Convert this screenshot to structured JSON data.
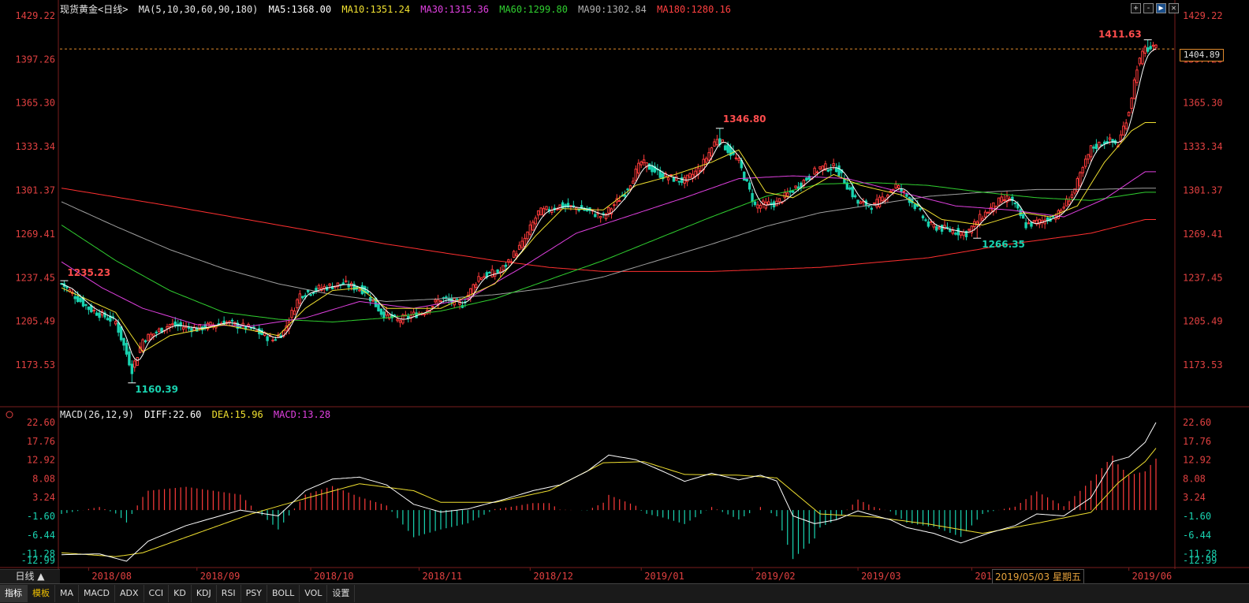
{
  "header": {
    "symbol": "现货黄金<日线>",
    "ma_params": "MA(5,10,30,60,90,180)",
    "ma5": "MA5:1368.00",
    "ma10": "MA10:1351.24",
    "ma30": "MA30:1315.36",
    "ma60": "MA60:1299.80",
    "ma90": "MA90:1302.84",
    "ma180": "MA180:1280.16"
  },
  "window_buttons": [
    "+",
    "-",
    "▶",
    "✕"
  ],
  "macd_header": {
    "params": "MACD(26,12,9)",
    "diff": "DIFF:22.60",
    "dea": "DEA:15.96",
    "macd": "MACD:13.28"
  },
  "price_axis": [
    "1429.22",
    "1397.26",
    "1365.30",
    "1333.34",
    "1301.37",
    "1269.41",
    "1237.45",
    "1205.49",
    "1173.53"
  ],
  "macd_axis": [
    "22.60",
    "17.76",
    "12.92",
    "8.08",
    "3.24",
    "-1.60",
    "-6.44",
    "-11.28",
    "-12.99"
  ],
  "x_axis": [
    "2018/08",
    "2018/09",
    "2018/10",
    "2018/11",
    "2018/12",
    "2019/01",
    "2019/02",
    "2019/03",
    "2019/04",
    "2019/06"
  ],
  "current_price": "1404.89",
  "annotations": {
    "high": "1411.63",
    "peak_feb": "1346.80",
    "start": "1235.23",
    "low_aug": "1160.39",
    "low_may": "1266.35"
  },
  "tooltip_date": "2019/05/03 星期五",
  "period_label": "日线 ▲",
  "bottom_tabs": [
    "指标",
    "模板",
    "MA",
    "MACD",
    "ADX",
    "CCI",
    "KD",
    "KDJ",
    "RSI",
    "PSY",
    "BOLL",
    "VOL",
    "设置"
  ],
  "colors": {
    "up": "#ff3b3b",
    "down": "#19d3b0",
    "ma5": "#ffffff",
    "ma10": "#f0e030",
    "ma30": "#e040e0",
    "ma60": "#30d030",
    "ma90": "#a0a0a0",
    "ma180": "#ff3030"
  },
  "chart_data": {
    "type": "candlestick",
    "title": "现货黄金<日线>",
    "ylim": [
      1160,
      1430
    ],
    "anchors": {
      "close": [
        [
          0,
          1233
        ],
        [
          10,
          1215
        ],
        [
          20,
          1205
        ],
        [
          26,
          1170
        ],
        [
          30,
          1192
        ],
        [
          40,
          1203
        ],
        [
          50,
          1200
        ],
        [
          60,
          1205
        ],
        [
          70,
          1200
        ],
        [
          78,
          1192
        ],
        [
          82,
          1198
        ],
        [
          88,
          1225
        ],
        [
          96,
          1230
        ],
        [
          104,
          1233
        ],
        [
          112,
          1228
        ],
        [
          118,
          1212
        ],
        [
          124,
          1206
        ],
        [
          134,
          1213
        ],
        [
          140,
          1222
        ],
        [
          148,
          1218
        ],
        [
          154,
          1238
        ],
        [
          162,
          1242
        ],
        [
          170,
          1262
        ],
        [
          176,
          1285
        ],
        [
          184,
          1290
        ],
        [
          192,
          1288
        ],
        [
          200,
          1282
        ],
        [
          208,
          1300
        ],
        [
          214,
          1322
        ],
        [
          222,
          1312
        ],
        [
          230,
          1308
        ],
        [
          236,
          1318
        ],
        [
          242,
          1340
        ],
        [
          250,
          1322
        ],
        [
          256,
          1290
        ],
        [
          264,
          1292
        ],
        [
          272,
          1305
        ],
        [
          280,
          1318
        ],
        [
          286,
          1318
        ],
        [
          294,
          1292
        ],
        [
          300,
          1290
        ],
        [
          308,
          1305
        ],
        [
          314,
          1293
        ],
        [
          320,
          1276
        ],
        [
          328,
          1272
        ],
        [
          334,
          1270
        ],
        [
          340,
          1283
        ],
        [
          346,
          1293
        ],
        [
          350,
          1296
        ],
        [
          356,
          1276
        ],
        [
          362,
          1279
        ],
        [
          368,
          1284
        ],
        [
          374,
          1302
        ],
        [
          380,
          1332
        ],
        [
          386,
          1338
        ],
        [
          390,
          1335
        ],
        [
          394,
          1360
        ],
        [
          397,
          1392
        ],
        [
          400,
          1405
        ]
      ],
      "ma10": [
        [
          0,
          1230
        ],
        [
          20,
          1212
        ],
        [
          30,
          1183
        ],
        [
          40,
          1195
        ],
        [
          60,
          1203
        ],
        [
          80,
          1195
        ],
        [
          90,
          1215
        ],
        [
          100,
          1228
        ],
        [
          110,
          1230
        ],
        [
          120,
          1215
        ],
        [
          140,
          1215
        ],
        [
          160,
          1233
        ],
        [
          175,
          1268
        ],
        [
          185,
          1288
        ],
        [
          200,
          1287
        ],
        [
          212,
          1305
        ],
        [
          225,
          1312
        ],
        [
          240,
          1322
        ],
        [
          250,
          1331
        ],
        [
          260,
          1300
        ],
        [
          270,
          1296
        ],
        [
          285,
          1313
        ],
        [
          295,
          1305
        ],
        [
          310,
          1298
        ],
        [
          325,
          1280
        ],
        [
          340,
          1276
        ],
        [
          355,
          1285
        ],
        [
          365,
          1282
        ],
        [
          375,
          1290
        ],
        [
          385,
          1322
        ],
        [
          395,
          1345
        ],
        [
          400,
          1351
        ]
      ],
      "ma30": [
        [
          0,
          1249
        ],
        [
          15,
          1230
        ],
        [
          30,
          1215
        ],
        [
          50,
          1203
        ],
        [
          70,
          1202
        ],
        [
          90,
          1208
        ],
        [
          110,
          1220
        ],
        [
          130,
          1215
        ],
        [
          150,
          1222
        ],
        [
          170,
          1245
        ],
        [
          190,
          1270
        ],
        [
          210,
          1283
        ],
        [
          230,
          1296
        ],
        [
          250,
          1310
        ],
        [
          270,
          1312
        ],
        [
          290,
          1310
        ],
        [
          310,
          1300
        ],
        [
          330,
          1290
        ],
        [
          350,
          1287
        ],
        [
          370,
          1282
        ],
        [
          385,
          1295
        ],
        [
          400,
          1315
        ]
      ],
      "ma60": [
        [
          0,
          1276
        ],
        [
          20,
          1250
        ],
        [
          40,
          1228
        ],
        [
          60,
          1212
        ],
        [
          80,
          1207
        ],
        [
          100,
          1205
        ],
        [
          120,
          1208
        ],
        [
          140,
          1213
        ],
        [
          160,
          1222
        ],
        [
          180,
          1236
        ],
        [
          200,
          1250
        ],
        [
          220,
          1266
        ],
        [
          240,
          1282
        ],
        [
          260,
          1297
        ],
        [
          280,
          1306
        ],
        [
          300,
          1307
        ],
        [
          320,
          1305
        ],
        [
          340,
          1300
        ],
        [
          360,
          1296
        ],
        [
          380,
          1294
        ],
        [
          400,
          1300
        ]
      ],
      "ma90": [
        [
          0,
          1293
        ],
        [
          20,
          1275
        ],
        [
          40,
          1258
        ],
        [
          60,
          1244
        ],
        [
          80,
          1233
        ],
        [
          100,
          1225
        ],
        [
          120,
          1220
        ],
        [
          140,
          1222
        ],
        [
          160,
          1225
        ],
        [
          180,
          1230
        ],
        [
          200,
          1238
        ],
        [
          220,
          1250
        ],
        [
          240,
          1262
        ],
        [
          260,
          1275
        ],
        [
          280,
          1285
        ],
        [
          300,
          1291
        ],
        [
          320,
          1297
        ],
        [
          340,
          1300
        ],
        [
          360,
          1302
        ],
        [
          380,
          1302
        ],
        [
          400,
          1303
        ]
      ],
      "ma180": [
        [
          0,
          1303
        ],
        [
          40,
          1290
        ],
        [
          80,
          1276
        ],
        [
          120,
          1262
        ],
        [
          160,
          1250
        ],
        [
          180,
          1245
        ],
        [
          200,
          1242
        ],
        [
          240,
          1242
        ],
        [
          280,
          1245
        ],
        [
          320,
          1252
        ],
        [
          350,
          1262
        ],
        [
          380,
          1270
        ],
        [
          400,
          1280
        ]
      ],
      "diff": [
        [
          0,
          -11.5
        ],
        [
          14,
          -11.3
        ],
        [
          24,
          -13.2
        ],
        [
          32,
          -8
        ],
        [
          46,
          -4
        ],
        [
          66,
          0
        ],
        [
          80,
          -1.5
        ],
        [
          90,
          5
        ],
        [
          100,
          8
        ],
        [
          110,
          8.5
        ],
        [
          120,
          6.5
        ],
        [
          130,
          1.5
        ],
        [
          140,
          -0.5
        ],
        [
          150,
          0.3
        ],
        [
          162,
          2.5
        ],
        [
          174,
          5
        ],
        [
          184,
          6.5
        ],
        [
          194,
          10
        ],
        [
          202,
          14.2
        ],
        [
          212,
          13
        ],
        [
          222,
          10
        ],
        [
          230,
          7.4
        ],
        [
          240,
          9.5
        ],
        [
          250,
          7.8
        ],
        [
          258,
          9
        ],
        [
          264,
          7.5
        ],
        [
          270,
          -1.5
        ],
        [
          278,
          -3.5
        ],
        [
          286,
          -2.5
        ],
        [
          294,
          -0.2
        ],
        [
          300,
          -1.4
        ],
        [
          306,
          -2.5
        ],
        [
          312,
          -4.5
        ],
        [
          322,
          -6
        ],
        [
          332,
          -8.5
        ],
        [
          342,
          -6
        ],
        [
          352,
          -4
        ],
        [
          360,
          -1
        ],
        [
          370,
          -1.5
        ],
        [
          380,
          3.2
        ],
        [
          388,
          12.5
        ],
        [
          394,
          13.7
        ],
        [
          400,
          17.5
        ],
        [
          404,
          22.6
        ]
      ],
      "dea": [
        [
          0,
          -11
        ],
        [
          20,
          -12
        ],
        [
          30,
          -11
        ],
        [
          50,
          -6
        ],
        [
          70,
          -1
        ],
        [
          90,
          3
        ],
        [
          110,
          6.8
        ],
        [
          130,
          5
        ],
        [
          140,
          2
        ],
        [
          160,
          2
        ],
        [
          180,
          5
        ],
        [
          200,
          12.2
        ],
        [
          215,
          12.5
        ],
        [
          230,
          9.2
        ],
        [
          250,
          9
        ],
        [
          264,
          8.3
        ],
        [
          280,
          -1
        ],
        [
          300,
          -1.8
        ],
        [
          320,
          -3.6
        ],
        [
          340,
          -6
        ],
        [
          360,
          -3.4
        ],
        [
          380,
          -0.6
        ],
        [
          390,
          7
        ],
        [
          400,
          12.5
        ],
        [
          404,
          15.96
        ]
      ]
    },
    "highlights": {
      "1": 1235.23,
      "26": 1160.39,
      "243": 1346.8,
      "338": 1266.35,
      "401": 1411.63
    }
  }
}
